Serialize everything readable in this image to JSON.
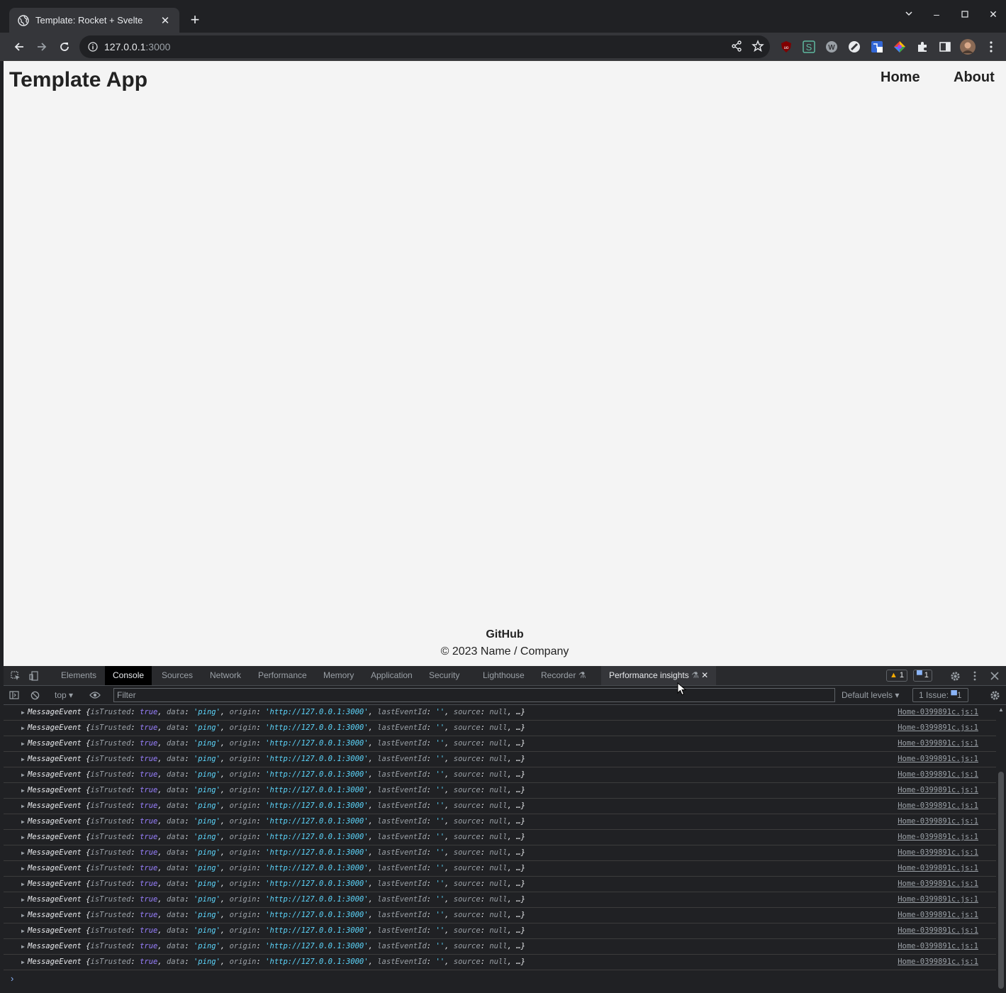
{
  "browser": {
    "tab_title": "Template: Rocket + Svelte",
    "tab_close": "✕",
    "new_tab": "+",
    "url_host": "127.0.0.1",
    "url_port": ":3000",
    "win_min": "–",
    "win_max": "☐",
    "win_close": "✕",
    "tab_list": "⌄"
  },
  "page": {
    "app_title": "Template App",
    "nav": [
      "Home",
      "About"
    ],
    "footer_link": "GitHub",
    "footer_copy": "© 2023 Name / Company"
  },
  "devtools": {
    "tabs": [
      "Elements",
      "Console",
      "Sources",
      "Network",
      "Performance",
      "Memory",
      "Application",
      "Security",
      "Lighthouse",
      "Recorder",
      "Performance insights"
    ],
    "active_tab": "Console",
    "warning_count": "1",
    "info_count": "1",
    "context": "top",
    "filter_placeholder": "Filter",
    "levels": "Default levels",
    "issues_label": "1 Issue:",
    "issues_count": "1",
    "log_entry": {
      "type": "MessageEvent",
      "isTrusted": "true",
      "data": "'ping'",
      "origin": "'http://127.0.0.1:3000'",
      "lastEventId": "''",
      "source": "null",
      "source_link": "Home-0399891c.js:1"
    },
    "log_count": 17
  },
  "colors": {
    "accent_blue": "#8ab4f8",
    "page_bg": "#f4f4f4",
    "warning": "#f9ab00"
  }
}
